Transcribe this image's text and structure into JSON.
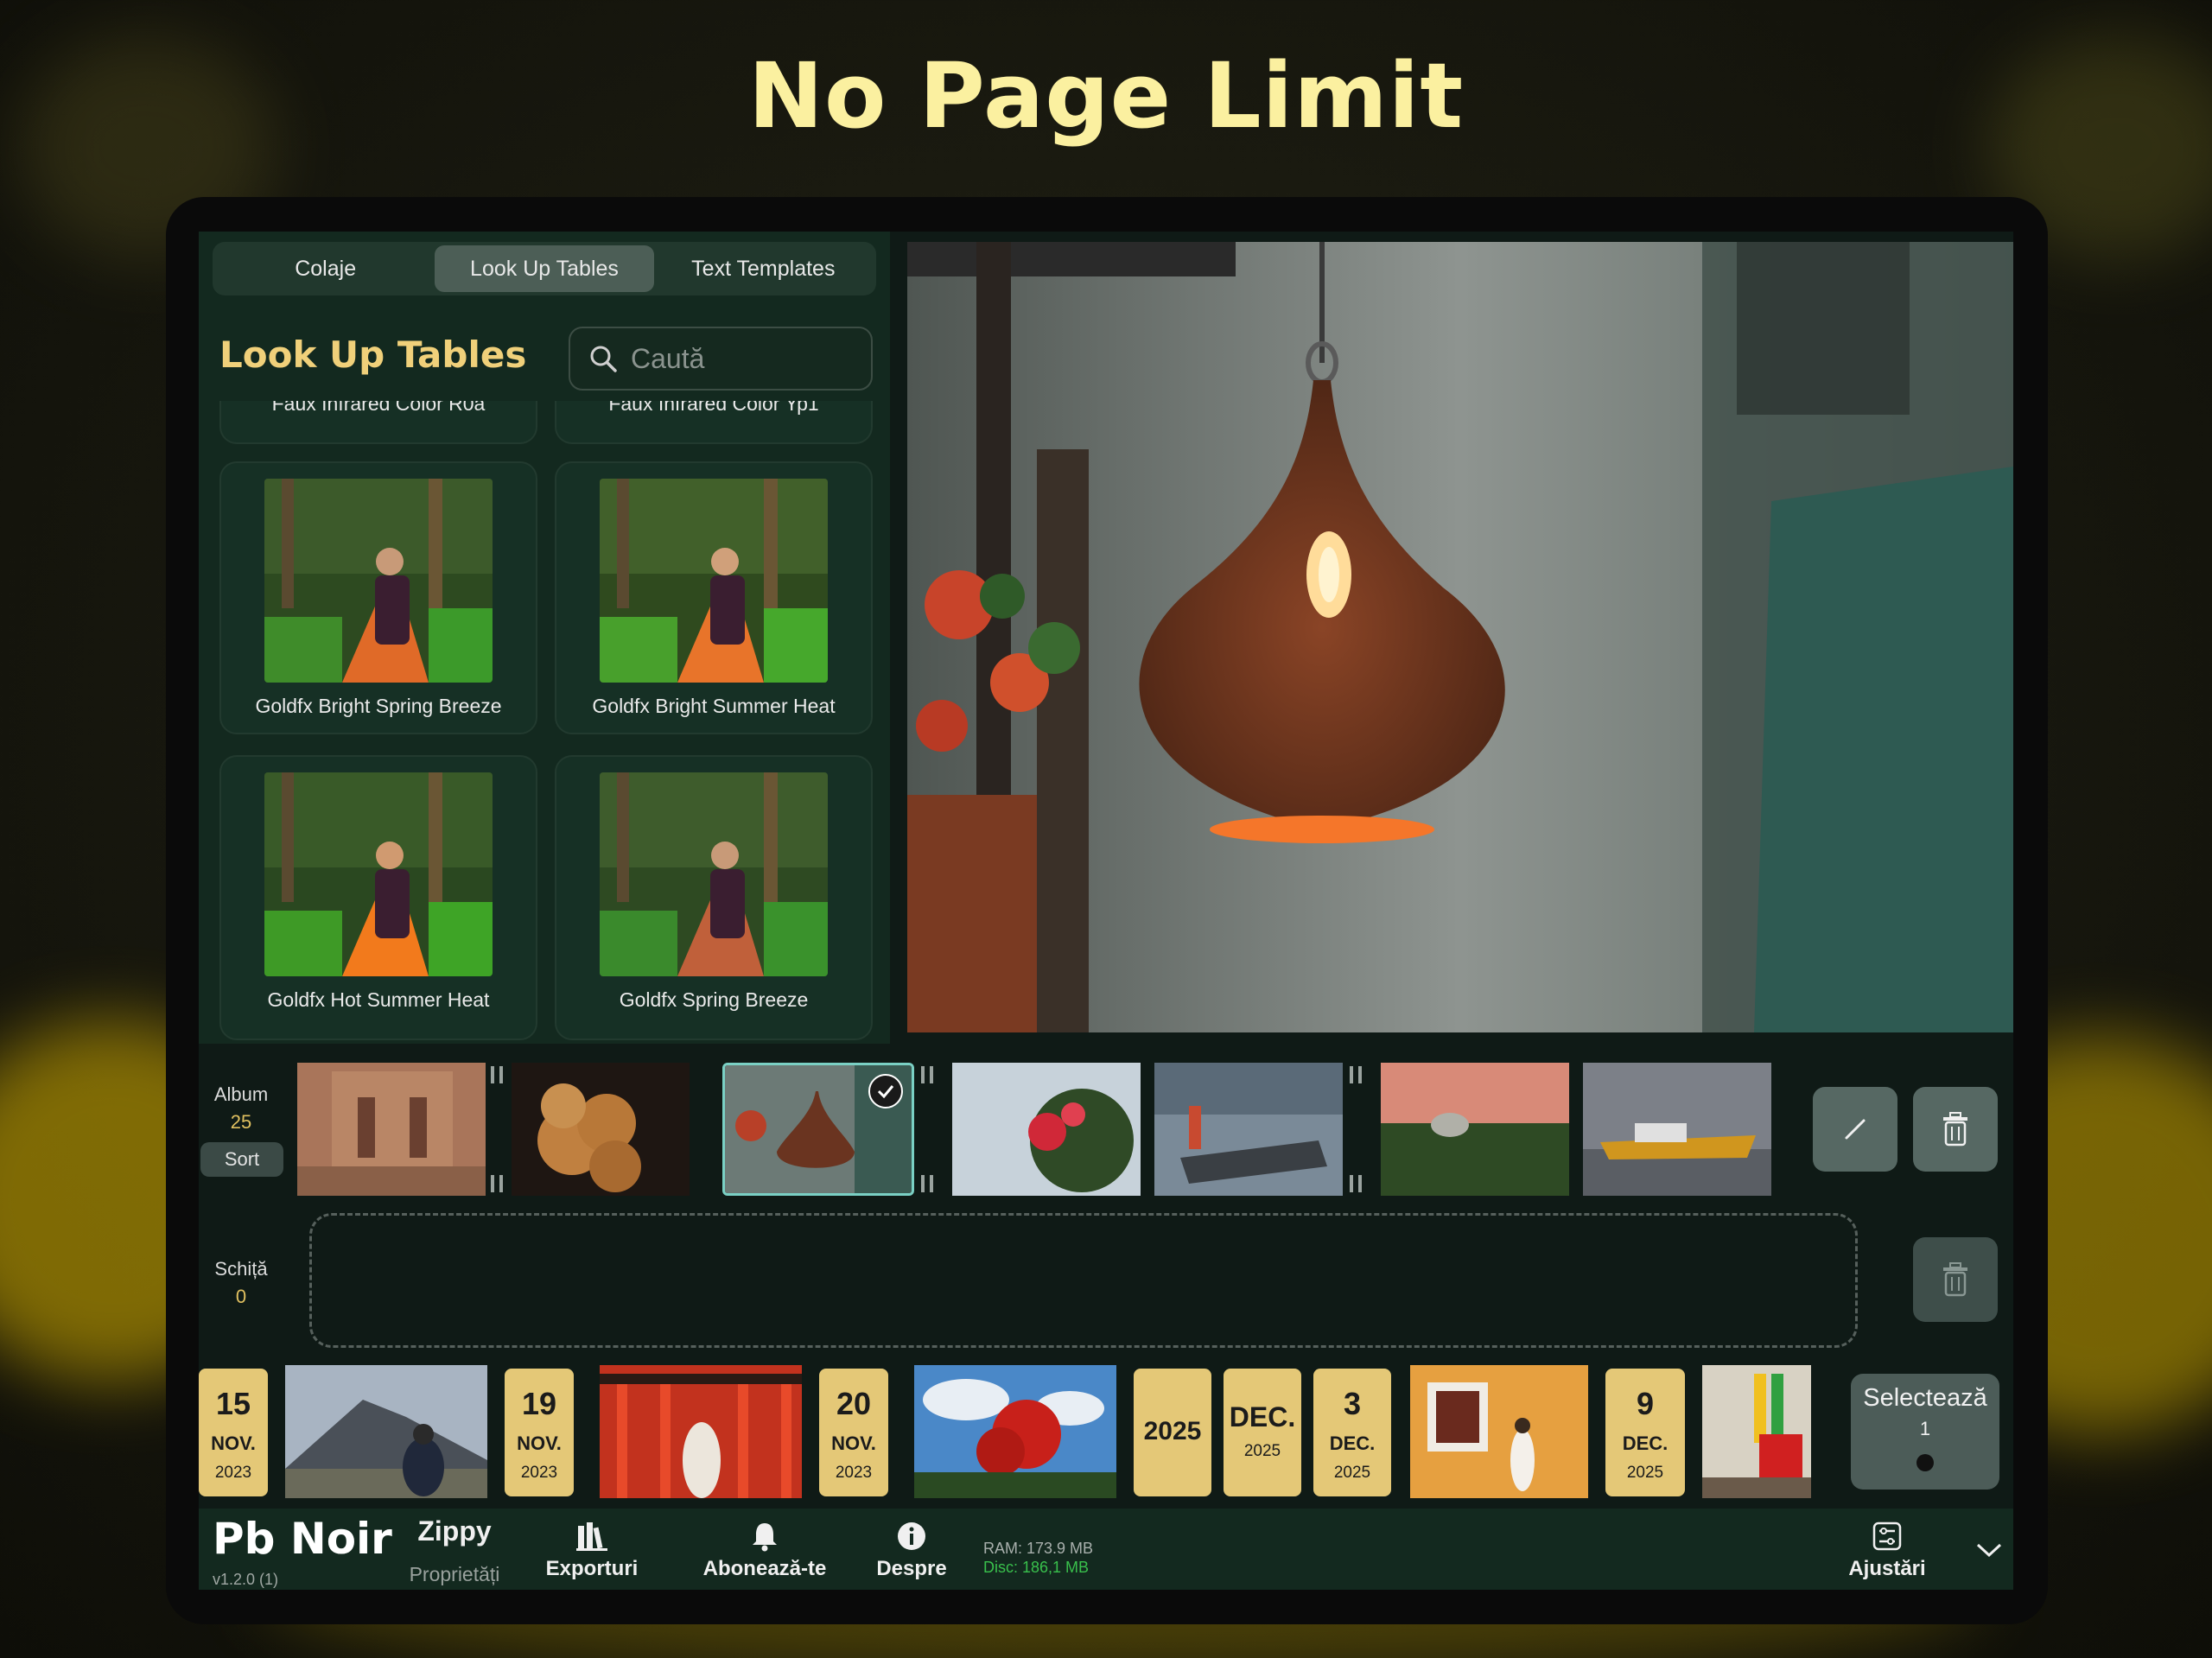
{
  "headline": "No Page Limit",
  "tabs": [
    {
      "label": "Colaje",
      "active": false
    },
    {
      "label": "Look Up Tables",
      "active": true
    },
    {
      "label": "Text Templates",
      "active": false
    }
  ],
  "lut_panel": {
    "title": "Look Up Tables",
    "search_placeholder": "Caută",
    "items": [
      "Faux Infrared Color R0a",
      "Faux Infrared Color Yp1",
      "Goldfx Bright Spring Breeze",
      "Goldfx Bright Summer Heat",
      "Goldfx Hot Summer Heat",
      "Goldfx Spring Breeze"
    ]
  },
  "album": {
    "label": "Album",
    "count": "25",
    "sort_label": "Sort"
  },
  "schita": {
    "label": "Schiță",
    "count": "0"
  },
  "timeline": {
    "dates": [
      {
        "day": "15",
        "month": "NOV.",
        "year": "2023"
      },
      {
        "day": "19",
        "month": "NOV.",
        "year": "2023"
      },
      {
        "day": "20",
        "month": "NOV.",
        "year": "2023"
      },
      {
        "year_only": "2025"
      },
      {
        "month": "DEC.",
        "year": "2025"
      },
      {
        "day": "3",
        "month": "DEC.",
        "year": "2025"
      },
      {
        "day": "9",
        "month": "DEC.",
        "year": "2025"
      }
    ],
    "select": {
      "label": "Selectează",
      "count": "1"
    }
  },
  "bottom_bar": {
    "brand": "Pb Noir",
    "version": "v1.2.0 (1)",
    "zippy": "Zippy",
    "zippy_sub": "Proprietăți",
    "exports": "Exporturi",
    "subscribe": "Abonează-te",
    "about": "Despre",
    "ram": "RAM: 173.9 MB",
    "disc": "Disc: 186,1 MB",
    "adjust": "Ajustări"
  },
  "colors": {
    "accent": "#f0d07a",
    "panel": "#13291f",
    "date_tile": "#e4c877",
    "disc_green": "#39c04c"
  }
}
